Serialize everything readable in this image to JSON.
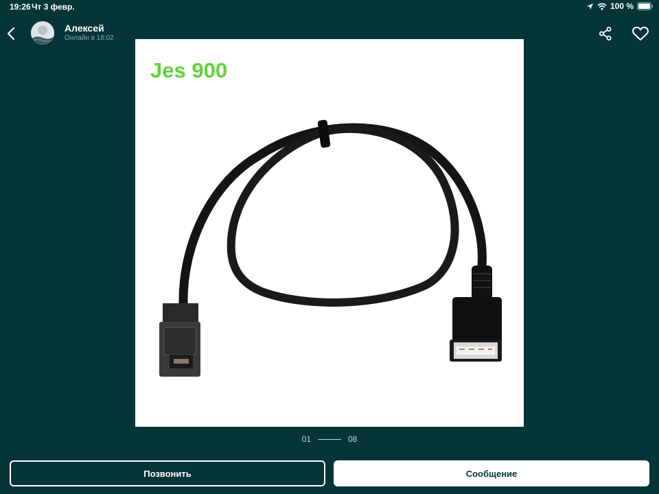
{
  "status_bar": {
    "time": "19:26",
    "date": "Чт 3 февр.",
    "battery": "100 %",
    "icons": [
      "location-arrow-icon",
      "wifi-icon",
      "battery-icon"
    ]
  },
  "header": {
    "user_name": "Алексей",
    "user_status": "Онлайн в 18:02",
    "icons": [
      "back-arrow-icon",
      "share-icon",
      "heart-icon"
    ]
  },
  "gallery": {
    "image_label": "Jes 900",
    "current_index": "01",
    "total": "08"
  },
  "actions": {
    "call_label": "Позвонить",
    "message_label": "Сообщение"
  },
  "colors": {
    "background": "#053537",
    "label_green": "#5fd33a",
    "button_white": "#ffffff"
  }
}
